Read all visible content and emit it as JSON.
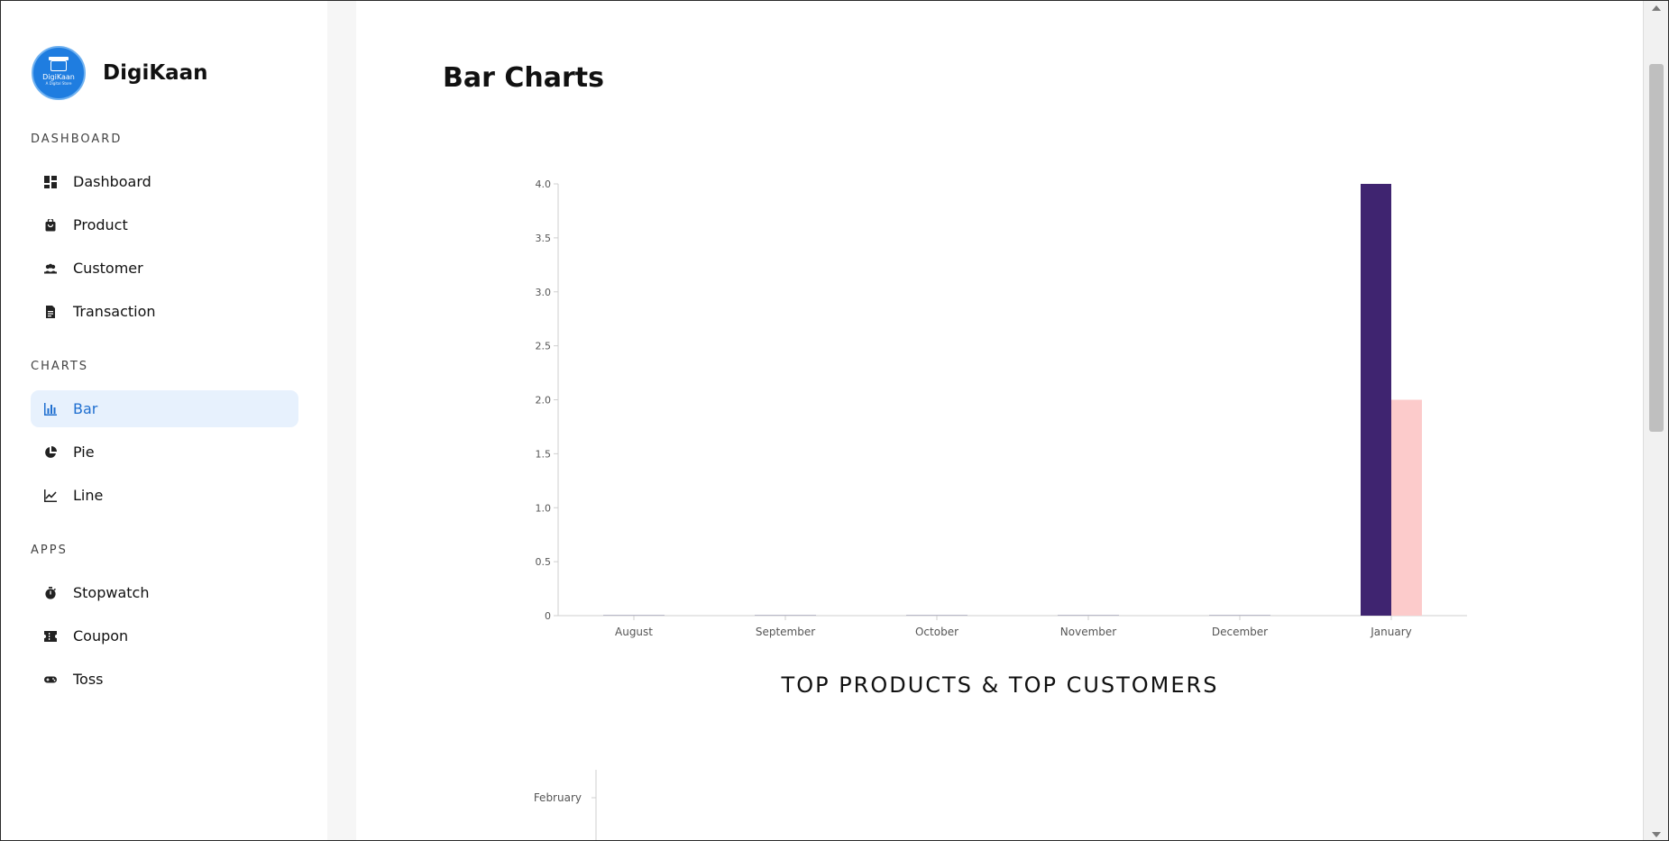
{
  "brand": {
    "title": "DigiKaan",
    "logo_name": "DigiKaan",
    "logo_tagline": "A Digital Store",
    "accent": "#1f7de0"
  },
  "sidebar": {
    "sections": [
      {
        "title": "DASHBOARD",
        "items": [
          {
            "label": "Dashboard",
            "icon": "dashboard-icon"
          },
          {
            "label": "Product",
            "icon": "shopping-bag-icon"
          },
          {
            "label": "Customer",
            "icon": "people-icon"
          },
          {
            "label": "Transaction",
            "icon": "document-icon"
          }
        ]
      },
      {
        "title": "CHARTS",
        "items": [
          {
            "label": "Bar",
            "icon": "bar-chart-icon",
            "active": true
          },
          {
            "label": "Pie",
            "icon": "pie-chart-icon"
          },
          {
            "label": "Line",
            "icon": "line-chart-icon"
          }
        ]
      },
      {
        "title": "APPS",
        "items": [
          {
            "label": "Stopwatch",
            "icon": "stopwatch-icon"
          },
          {
            "label": "Coupon",
            "icon": "coupon-icon"
          },
          {
            "label": "Toss",
            "icon": "gamepad-icon"
          }
        ]
      }
    ]
  },
  "main": {
    "title": "Bar Charts",
    "section_heading": "TOP PRODUCTS & TOP CUSTOMERS"
  },
  "chart_data": [
    {
      "type": "bar",
      "categories": [
        "August",
        "September",
        "October",
        "November",
        "December",
        "January"
      ],
      "series": [
        {
          "values": [
            0,
            0,
            0,
            0,
            0,
            4
          ],
          "color": "#3f2470"
        },
        {
          "values": [
            0,
            0,
            0,
            0,
            0,
            2
          ],
          "color": "#fccbcb"
        }
      ],
      "ylim": [
        0,
        4
      ],
      "yticks": [
        "0",
        "0.5",
        "1.0",
        "1.5",
        "2.0",
        "2.5",
        "3.0",
        "3.5",
        "4.0"
      ],
      "grid": false
    },
    {
      "type": "bar",
      "orientation": "horizontal",
      "categories": [
        "February"
      ]
    }
  ]
}
